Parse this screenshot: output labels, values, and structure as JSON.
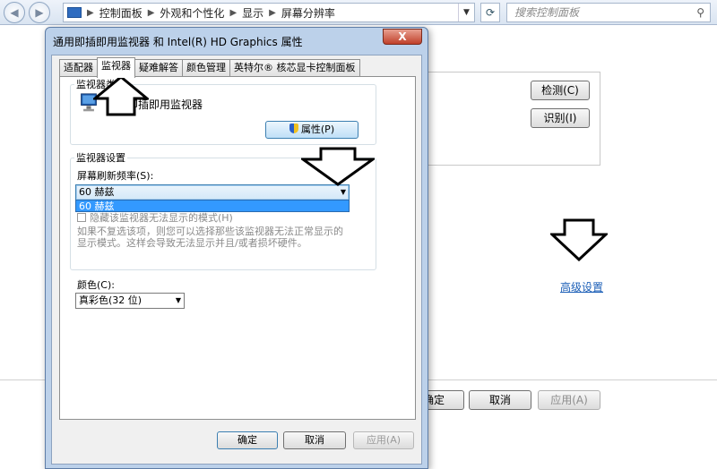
{
  "explorer": {
    "breadcrumb": [
      "控制面板",
      "外观和个性化",
      "显示",
      "屏幕分辨率"
    ],
    "search_placeholder": "搜索控制面板",
    "detect_button": "检测(C)",
    "identify_button": "识别(I)",
    "advanced_link": "高级设置",
    "ok_button": "确定",
    "cancel_button": "取消",
    "apply_button": "应用(A)"
  },
  "dialog": {
    "title": "通用即插即用监视器 和 Intel(R) HD Graphics 属性",
    "close_label": "X",
    "tabs": [
      {
        "label": "适配器",
        "active": false
      },
      {
        "label": "监视器",
        "active": true
      },
      {
        "label": "疑难解答",
        "active": false
      },
      {
        "label": "颜色管理",
        "active": false
      },
      {
        "label": "英特尔® 核芯显卡控制面板",
        "active": false
      }
    ],
    "monitor_type_group": "监视器类型",
    "monitor_name": "通用即插即用监视器",
    "properties_button": "属性(P)",
    "monitor_settings_group": "监视器设置",
    "refresh_rate_label": "屏幕刷新频率(S):",
    "refresh_rate_value": "60 赫兹",
    "refresh_rate_option": "60 赫兹",
    "hide_modes_label": "隐藏该监视器无法显示的模式(H)",
    "hide_modes_desc_1": "如果不复选该项，则您可以选择那些该监视器无法正常显示的",
    "hide_modes_desc_2": "显示模式。这样会导致无法显示并且/或者损坏硬件。",
    "color_label": "颜色(C):",
    "color_value": "真彩色(32 位)",
    "ok_button": "确定",
    "cancel_button": "取消",
    "apply_button": "应用(A)"
  }
}
